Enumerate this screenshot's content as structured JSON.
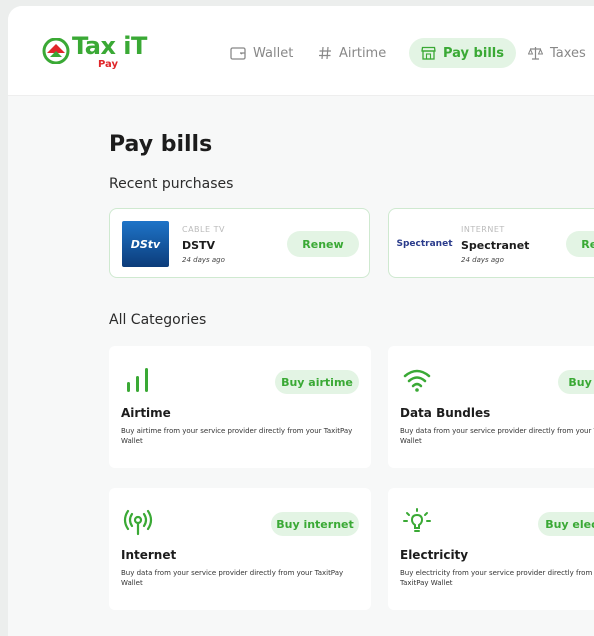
{
  "brand": {
    "name": "Tax iT",
    "sub": "Pay"
  },
  "nav": [
    {
      "label": "Wallet",
      "icon": "wallet-icon"
    },
    {
      "label": "Airtime",
      "icon": "hash-icon"
    },
    {
      "label": "Pay bills",
      "icon": "storefront-icon",
      "active": true
    },
    {
      "label": "Taxes",
      "icon": "scales-icon"
    }
  ],
  "page": {
    "title": "Pay bills",
    "recent_heading": "Recent purchases",
    "categories_heading": "All Categories"
  },
  "recent": [
    {
      "category": "CABLE TV",
      "name": "DSTV",
      "time": "24 days ago",
      "action": "Renew",
      "logo_text": "DStv"
    },
    {
      "category": "INTERNET",
      "name": "Spectranet",
      "time": "24 days ago",
      "action": "Renew",
      "logo_text": "Spectranet"
    }
  ],
  "categories": [
    {
      "title": "Airtime",
      "button": "Buy airtime",
      "description": "Buy airtime from your service provider directly from your TaxitPay Wallet",
      "icon": "signal-bars-icon"
    },
    {
      "title": "Data Bundles",
      "button": "Buy data",
      "description": "Buy data from your service provider directly from your TaxitPay Wallet",
      "icon": "wifi-icon"
    },
    {
      "title": "Internet",
      "button": "Buy internet",
      "description": "Buy data from your service provider directly from your TaxitPay Wallet",
      "icon": "broadcast-icon"
    },
    {
      "title": "Electricity",
      "button": "Buy electricity",
      "description": "Buy electricity from your service provider directly from your TaxitPay Wallet",
      "icon": "lightbulb-icon"
    }
  ],
  "colors": {
    "accent": "#3aa935",
    "accent_bg": "#e3f4e4",
    "brand_red": "#e0262a"
  }
}
